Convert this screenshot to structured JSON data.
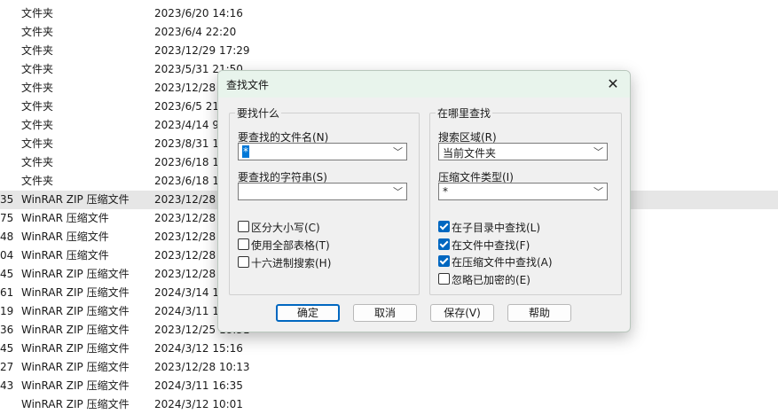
{
  "file_list": [
    {
      "num": "",
      "type": "文件夹",
      "date": "2023/6/20 14:16"
    },
    {
      "num": "",
      "type": "文件夹",
      "date": "2023/6/4 22:20"
    },
    {
      "num": "",
      "type": "文件夹",
      "date": "2023/12/29 17:29"
    },
    {
      "num": "",
      "type": "文件夹",
      "date": "2023/5/31 21:50"
    },
    {
      "num": "",
      "type": "文件夹",
      "date": "2023/12/28"
    },
    {
      "num": "",
      "type": "文件夹",
      "date": "2023/6/5 21"
    },
    {
      "num": "",
      "type": "文件夹",
      "date": "2023/4/14 9"
    },
    {
      "num": "",
      "type": "文件夹",
      "date": "2023/8/31 1"
    },
    {
      "num": "",
      "type": "文件夹",
      "date": "2023/6/18 1"
    },
    {
      "num": "",
      "type": "文件夹",
      "date": "2023/6/18 1"
    },
    {
      "num": "35",
      "type": "WinRAR ZIP 压缩文件",
      "date": "2023/12/28"
    },
    {
      "num": "75",
      "type": "WinRAR 压缩文件",
      "date": "2023/12/28"
    },
    {
      "num": "48",
      "type": "WinRAR 压缩文件",
      "date": "2023/12/28"
    },
    {
      "num": "04",
      "type": "WinRAR 压缩文件",
      "date": "2023/12/28"
    },
    {
      "num": "45",
      "type": "WinRAR ZIP 压缩文件",
      "date": "2023/12/28"
    },
    {
      "num": "61",
      "type": "WinRAR ZIP 压缩文件",
      "date": "2024/3/14 1"
    },
    {
      "num": "19",
      "type": "WinRAR ZIP 压缩文件",
      "date": "2024/3/11 1"
    },
    {
      "num": "36",
      "type": "WinRAR ZIP 压缩文件",
      "date": "2023/12/25 18:31"
    },
    {
      "num": "45",
      "type": "WinRAR ZIP 压缩文件",
      "date": "2024/3/12 15:16"
    },
    {
      "num": "27",
      "type": "WinRAR ZIP 压缩文件",
      "date": "2023/12/28 10:13"
    },
    {
      "num": "43",
      "type": "WinRAR ZIP 压缩文件",
      "date": "2024/3/11 16:35"
    },
    {
      "num": "",
      "type": "WinRAR ZIP 压缩文件",
      "date": "2024/3/12 10:01"
    }
  ],
  "dialog": {
    "title": "查找文件",
    "close_glyph": "✕",
    "left_group": {
      "title": "要找什么",
      "filename_label": "要查找的文件名(N)",
      "filename_value": "*",
      "string_label": "要查找的字符串(S)",
      "string_value": "",
      "checkboxes": [
        {
          "label": "区分大小写(C)",
          "checked": false
        },
        {
          "label": "使用全部表格(T)",
          "checked": false
        },
        {
          "label": "十六进制搜索(H)",
          "checked": false
        }
      ]
    },
    "right_group": {
      "title": "在哪里查找",
      "area_label": "搜索区域(R)",
      "area_value": "当前文件夹",
      "archive_type_label": "压缩文件类型(I)",
      "archive_type_value": "*",
      "checkboxes": [
        {
          "label": "在子目录中查找(L)",
          "checked": true
        },
        {
          "label": "在文件中查找(F)",
          "checked": true
        },
        {
          "label": "在压缩文件中查找(A)",
          "checked": true
        },
        {
          "label": "忽略已加密的(E)",
          "checked": false
        }
      ]
    },
    "buttons": {
      "ok": "确定",
      "cancel": "取消",
      "save": "保存(V)",
      "help": "帮助"
    },
    "dropdown_glyph": "﹀"
  }
}
